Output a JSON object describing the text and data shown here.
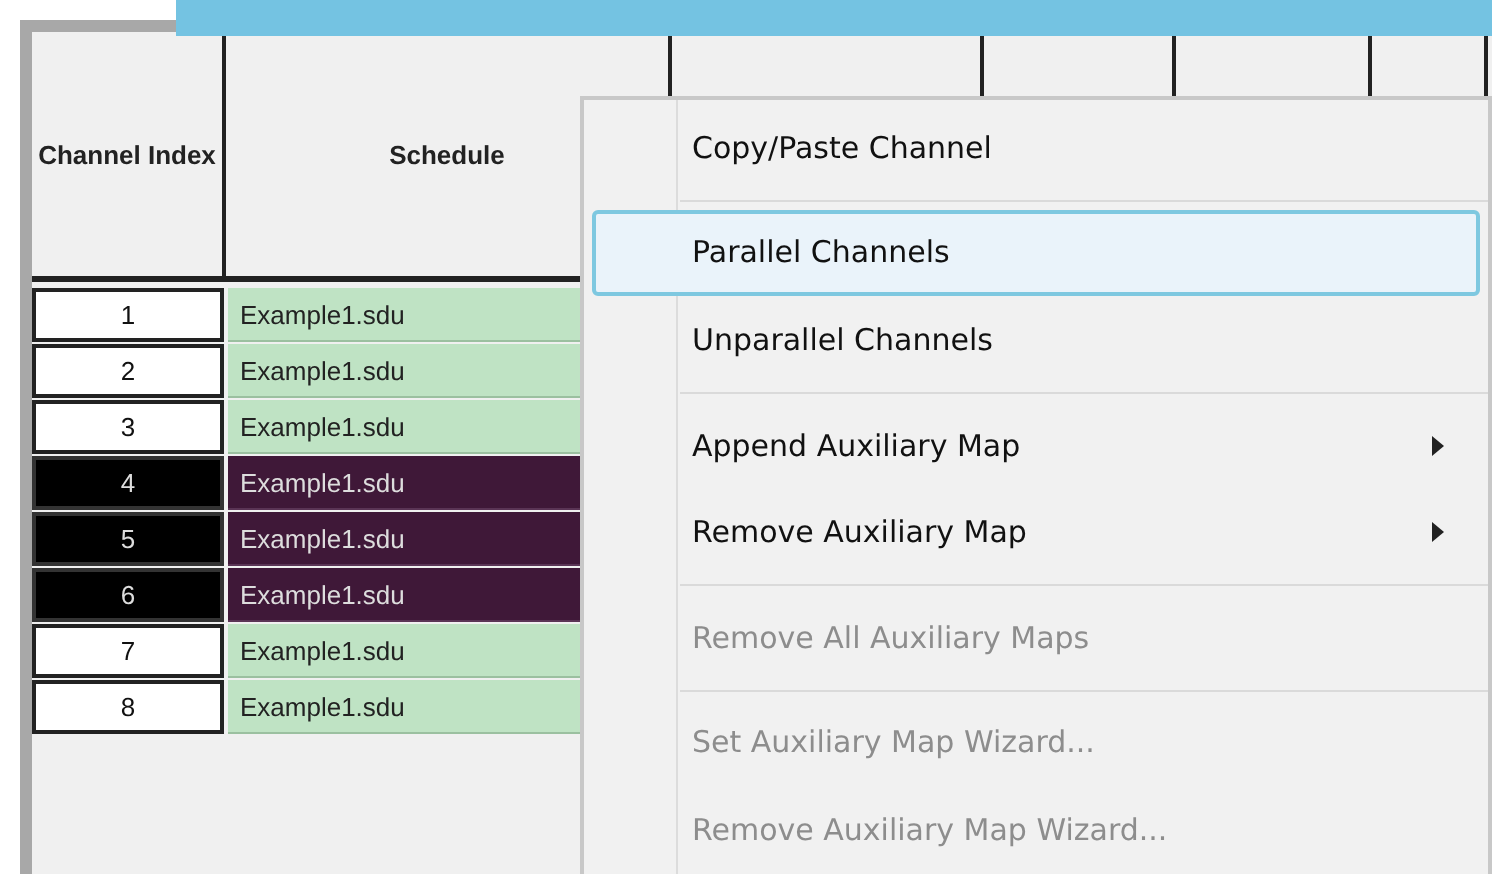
{
  "table": {
    "columns": [
      "Channel Index",
      "Schedule"
    ],
    "rows": [
      {
        "index": "1",
        "schedule": "Example1.sdu",
        "selected": false
      },
      {
        "index": "2",
        "schedule": "Example1.sdu",
        "selected": false
      },
      {
        "index": "3",
        "schedule": "Example1.sdu",
        "selected": false
      },
      {
        "index": "4",
        "schedule": "Example1.sdu",
        "selected": true
      },
      {
        "index": "5",
        "schedule": "Example1.sdu",
        "selected": true
      },
      {
        "index": "6",
        "schedule": "Example1.sdu",
        "selected": true
      },
      {
        "index": "7",
        "schedule": "Example1.sdu",
        "selected": false
      },
      {
        "index": "8",
        "schedule": "Example1.sdu",
        "selected": false
      }
    ]
  },
  "context_menu": {
    "items": [
      {
        "kind": "item",
        "label": "Copy/Paste Channel",
        "selected": false,
        "disabled": false,
        "submenu": false
      },
      {
        "kind": "separator"
      },
      {
        "kind": "item",
        "label": "Parallel Channels",
        "selected": true,
        "disabled": false,
        "submenu": false
      },
      {
        "kind": "item",
        "label": "Unparallel Channels",
        "selected": false,
        "disabled": false,
        "submenu": false
      },
      {
        "kind": "separator"
      },
      {
        "kind": "item",
        "label": "Append Auxiliary Map",
        "selected": false,
        "disabled": false,
        "submenu": true
      },
      {
        "kind": "item",
        "label": "Remove Auxiliary Map",
        "selected": false,
        "disabled": false,
        "submenu": true
      },
      {
        "kind": "separator"
      },
      {
        "kind": "item",
        "label": "Remove All Auxiliary Maps",
        "selected": false,
        "disabled": true,
        "submenu": false
      },
      {
        "kind": "separator"
      },
      {
        "kind": "item",
        "label": "Set Auxiliary Map Wizard...",
        "selected": false,
        "disabled": true,
        "submenu": false
      },
      {
        "kind": "item",
        "label": "Remove Auxiliary Map Wizard...",
        "selected": false,
        "disabled": true,
        "submenu": false
      }
    ]
  }
}
